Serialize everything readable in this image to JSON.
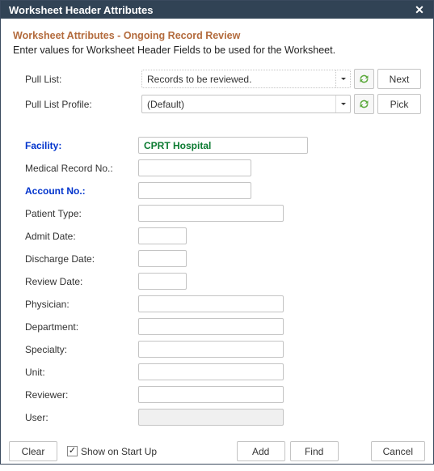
{
  "window": {
    "title": "Worksheet Header Attributes"
  },
  "header": {
    "subtitle": "Worksheet Attributes - Ongoing Record Review",
    "instructions": "Enter values for Worksheet Header Fields to be used for the Worksheet."
  },
  "pull_list": {
    "label": "Pull List:",
    "value": "Records to be reviewed.",
    "button": "Next"
  },
  "pull_profile": {
    "label": "Pull List Profile:",
    "value": "(Default)",
    "button": "Pick"
  },
  "form": {
    "facility": {
      "label": "Facility:",
      "value": "CPRT Hospital"
    },
    "mrn": {
      "label": "Medical Record No.:",
      "value": ""
    },
    "account": {
      "label": "Account No.:",
      "value": ""
    },
    "patient_type": {
      "label": "Patient Type:",
      "value": ""
    },
    "admit_date": {
      "label": "Admit Date:",
      "value": ""
    },
    "discharge_date": {
      "label": "Discharge Date:",
      "value": ""
    },
    "review_date": {
      "label": "Review Date:",
      "value": ""
    },
    "physician": {
      "label": "Physician:",
      "value": ""
    },
    "department": {
      "label": "Department:",
      "value": ""
    },
    "specialty": {
      "label": "Specialty:",
      "value": ""
    },
    "unit": {
      "label": "Unit:",
      "value": ""
    },
    "reviewer": {
      "label": "Reviewer:",
      "value": ""
    },
    "user": {
      "label": "User:",
      "value": ""
    }
  },
  "footer": {
    "clear": "Clear",
    "show_on_startup": "Show on Start Up",
    "show_on_startup_checked": "✓",
    "add": "Add",
    "find": "Find",
    "cancel": "Cancel"
  }
}
